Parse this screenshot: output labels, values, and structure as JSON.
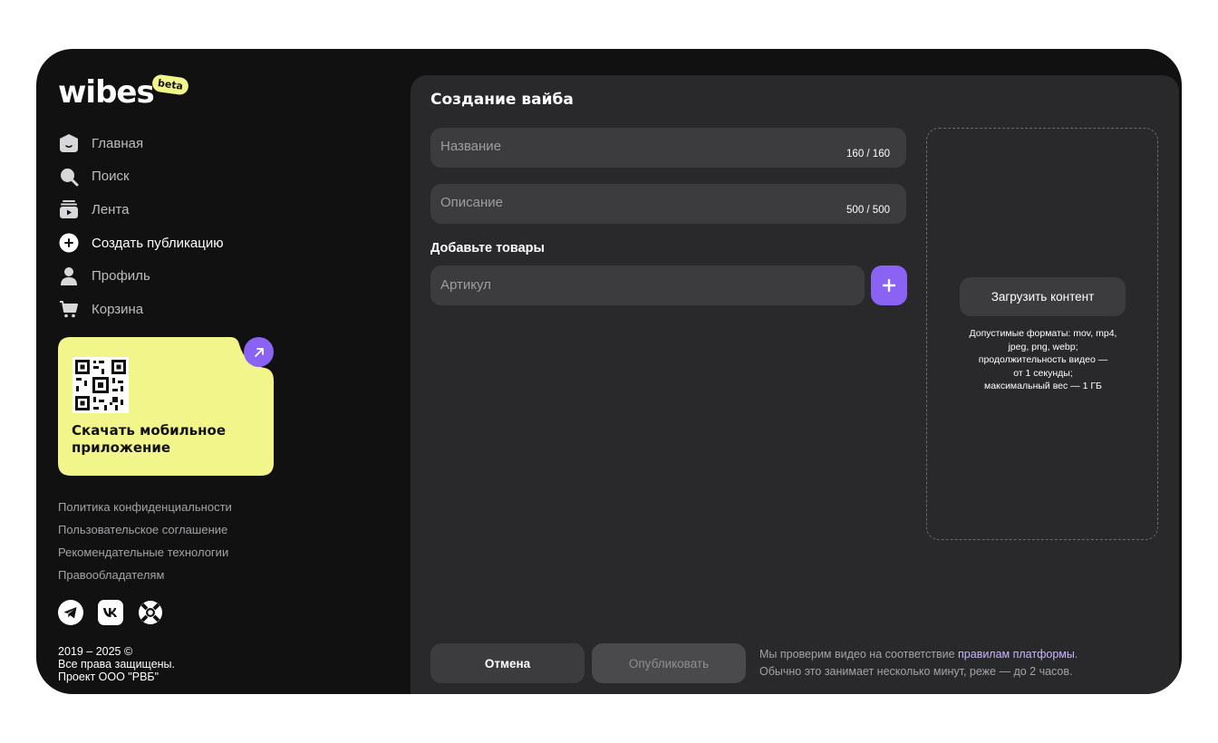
{
  "brand": {
    "logo_text": "wibes",
    "badge": "beta"
  },
  "sidebar": {
    "items": [
      {
        "label": "Главная",
        "icon": "home-icon"
      },
      {
        "label": "Поиск",
        "icon": "search-icon"
      },
      {
        "label": "Лента",
        "icon": "feed-icon"
      },
      {
        "label": "Создать публикацию",
        "icon": "plus-circle-icon"
      },
      {
        "label": "Профиль",
        "icon": "profile-icon"
      },
      {
        "label": "Корзина",
        "icon": "cart-icon"
      }
    ],
    "active_item": "Создать публикацию"
  },
  "promo": {
    "text": "Скачать мобильное приложение",
    "bg_color": "#f2f58a",
    "accent_color": "#8a63f4"
  },
  "footer_links": [
    "Политика конфиденциальности",
    "Пользовательское соглашение",
    "Рекомендательные технологии",
    "Правообладателям"
  ],
  "socials": [
    "telegram-icon",
    "vk-icon",
    "support-lifebuoy-icon"
  ],
  "copyright": {
    "line1": "2019 – 2025 ©",
    "line2": "Все права защищены.",
    "line3": "Проект ООО \"РВБ\""
  },
  "form": {
    "title": "Создание вайба",
    "name_placeholder": "Название",
    "name_counter": "160 / 160",
    "description_placeholder": "Описание",
    "description_counter": "500 / 500",
    "products_label": "Добавьте товары",
    "article_placeholder": "Артикул"
  },
  "upload": {
    "button_label": "Загрузить контент",
    "hint_line1": "Допустимые форматы: mov, mp4,",
    "hint_line2": "jpeg, png, webp;",
    "hint_line3": "продолжительность видео —",
    "hint_line4": "от 1 секунды;",
    "hint_line5": "максимальный вес — 1 ГБ"
  },
  "actions": {
    "cancel_label": "Отмена",
    "publish_label": "Опубликовать",
    "note_prefix": "Мы проверим видео на соответствие ",
    "note_link": "правилам платформы",
    "note_suffix": ".",
    "note_line2": "Обычно это занимает несколько минут, реже — до 2 часов."
  },
  "colors": {
    "accent": "#8a63f4",
    "sidebar_bg": "#111112",
    "panel_bg": "#29292b",
    "field_bg": "#3c3c3e"
  }
}
